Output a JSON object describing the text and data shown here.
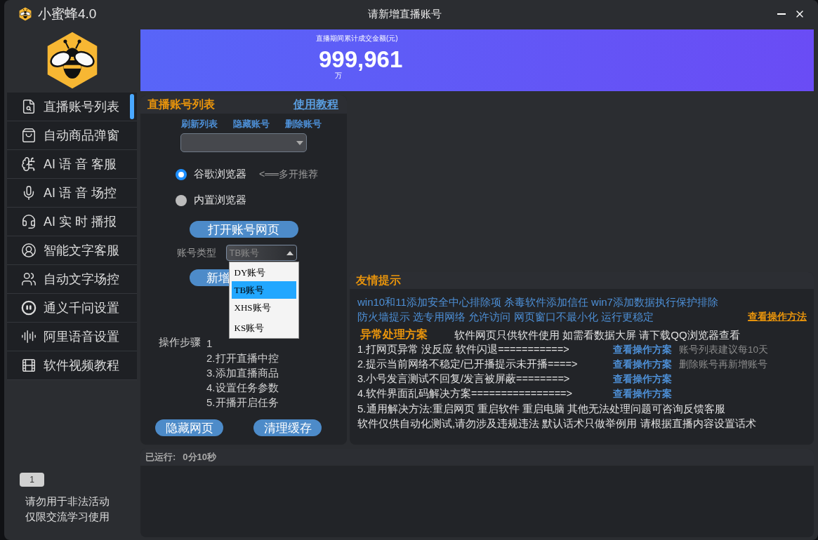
{
  "titlebar": {
    "app_name": "小蜜蜂4.0",
    "title": "请新增直播账号"
  },
  "banner": {
    "caption": "直播期间累计成交金额(元)",
    "value": "999,961",
    "unit": "万"
  },
  "sidebar": {
    "items": [
      {
        "label": "直播账号列表"
      },
      {
        "label": "自动商品弹窗"
      },
      {
        "label": "AI 语 音 客服"
      },
      {
        "label": "AI 语 音 场控"
      },
      {
        "label": "AI 实 时 播报"
      },
      {
        "label": "智能文字客服"
      },
      {
        "label": "自动文字场控"
      },
      {
        "label": "通义千问设置"
      },
      {
        "label": "阿里语音设置"
      },
      {
        "label": "软件视频教程"
      }
    ],
    "badge": "1",
    "notice": [
      "请勿用于非法活动",
      "仅限交流学习使用"
    ]
  },
  "account_panel": {
    "title": "直播账号列表",
    "help_link": "使用教程",
    "actions": [
      "刷新列表",
      "隐藏账号",
      "删除账号"
    ],
    "browsers": [
      {
        "label": "谷歌浏览器",
        "selected": true
      },
      {
        "label": "内置浏览器",
        "selected": false
      }
    ],
    "browser_hint": "<══多开推荐",
    "open_button": "打开账号网页",
    "type_label": "账号类型",
    "type_select": {
      "value": "TB账号",
      "expanded": true,
      "options": [
        {
          "label": "DY账号",
          "selected": false
        },
        {
          "label": "TB账号",
          "selected": true
        },
        {
          "label": "XHS账号",
          "selected": false
        },
        {
          "label": "KS账号",
          "selected": false
        }
      ]
    },
    "add_button": "新增",
    "steps_label": "操作步骤",
    "steps": [
      "1",
      "2.打开直播中控",
      "3.添加直播商品",
      "4.设置任务参数",
      "5.开播开启任务"
    ],
    "bottom_buttons": [
      "隐藏网页",
      "清理缓存"
    ]
  },
  "tips": {
    "title": "友情提示",
    "lines": [
      "win10和11添加安全中心排除项  杀毒软件添加信任 win7添加数据执行保护排除",
      "防火墙提示 选专用网络 允许访问 网页窗口不最小化 运行更稳定"
    ],
    "link": "查看操作方法",
    "section_title": "异常处理方案",
    "section_note": "软件网页只供软件使用  如需看数据大屏  请下载QQ浏览器查看",
    "items": [
      {
        "text": "1.打网页异常 没反应 软件闪退===========>",
        "link": "查看操作方案",
        "note": "账号列表建议每10天"
      },
      {
        "text": "2.提示当前网络不稳定/已开播提示未开播====>",
        "link": "查看操作方案",
        "note": "删除账号再新增账号"
      },
      {
        "text": "3.小号发言测试不回复/发言被屏蔽========>",
        "link": "查看操作方案"
      },
      {
        "text": "4.软件界面乱码解决方案================>",
        "link": "查看操作方案"
      }
    ],
    "footer": [
      "5.通用解决方法:重启网页 重启软件 重启电脑 其他无法处理问题可咨询反馈客服",
      "软件仅供自动化测试,请勿涉及违规违法 默认话术只做举例用 请根据直播内容设置话术"
    ]
  },
  "log": {
    "label": "已运行:",
    "value": "0分10秒"
  }
}
